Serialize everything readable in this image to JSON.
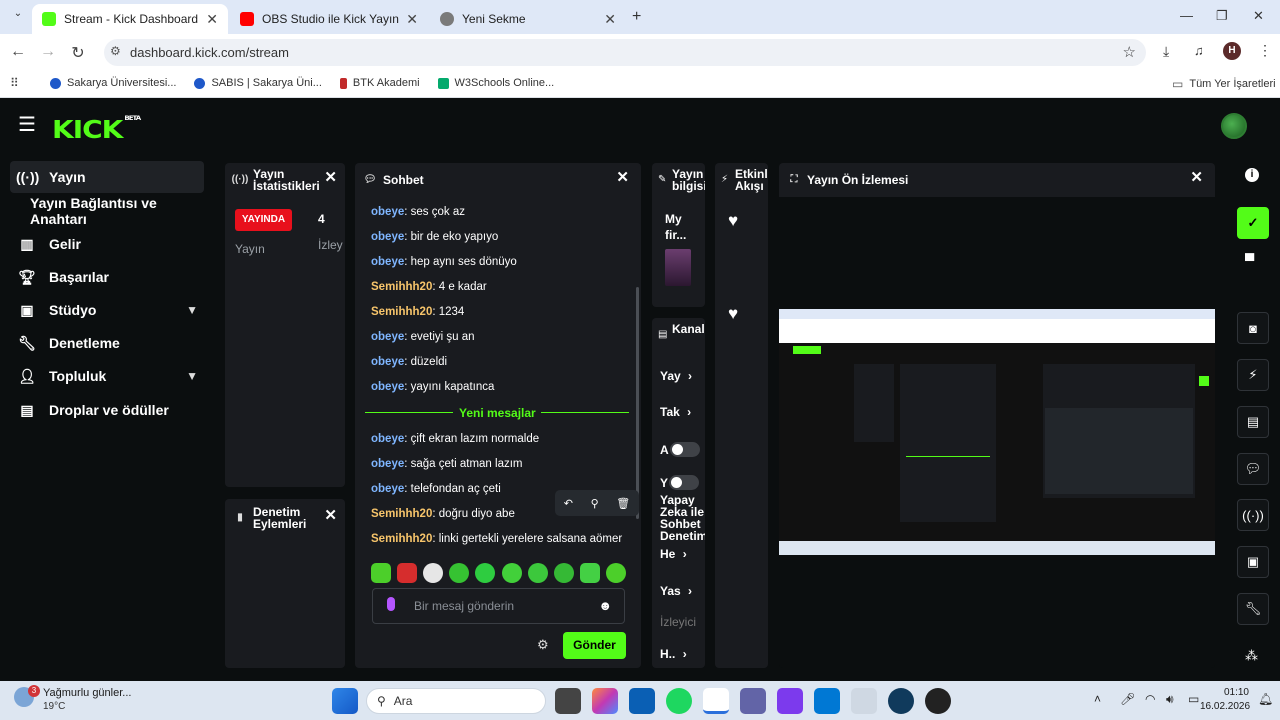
{
  "browser": {
    "tabs": [
      {
        "title": "Stream - Kick Dashboard",
        "color": "#53fc18"
      },
      {
        "title": "OBS Studio ile Kick Yayını Nasıl",
        "color": "#ff0000"
      },
      {
        "title": "Yeni Sekme",
        "color": "#777777"
      }
    ],
    "url": "dashboard.kick.com/stream",
    "profile_initial": "H",
    "bookmarks": [
      "Sakarya Üniversitesi...",
      "SABIS | Sakarya Üni...",
      "BTK Akademi",
      "W3Schools Online..."
    ],
    "all_bookmarks": "Tüm Yer İşaretleri"
  },
  "kick": {
    "logo": "KICK",
    "logo_badge": "BETA",
    "sidebar": [
      {
        "label": "Yayın",
        "icon": "broadcast-icon"
      },
      {
        "label": "Yayın Bağlantısı ve Anahtarı",
        "icon": ""
      },
      {
        "label": "Gelir",
        "icon": "chart-icon"
      },
      {
        "label": "Başarılar",
        "icon": "trophy-icon"
      },
      {
        "label": "Stüdyo",
        "icon": "studio-icon"
      },
      {
        "label": "Denetleme",
        "icon": "wrench-icon"
      },
      {
        "label": "Topluluk",
        "icon": "person-icon"
      },
      {
        "label": "Droplar ve ödüller",
        "icon": "drops-icon"
      }
    ],
    "stats": {
      "title": "Yayın İstatistikleri",
      "live": "YAYINDA",
      "count": "4",
      "label1": "Yayın",
      "label2": "İzley"
    },
    "mod_actions": {
      "title": "Denetim Eylemleri"
    },
    "chat": {
      "title": "Sohbet",
      "messages": [
        {
          "user": "obeye",
          "text": "ses çok az"
        },
        {
          "user": "obeye",
          "text": "bir de eko yapıyo"
        },
        {
          "user": "obeye",
          "text": "hep aynı ses dönüyo"
        },
        {
          "user": "Semihhh20",
          "text": "4 e kadar"
        },
        {
          "user": "Semihhh20",
          "text": "1234"
        },
        {
          "user": "obeye",
          "text": "evetiyi şu an"
        },
        {
          "user": "obeye",
          "text": "düzeldi"
        },
        {
          "user": "obeye",
          "text": "yayını kapatınca"
        }
      ],
      "new_label": "Yeni mesajlar",
      "new_messages": [
        {
          "user": "obeye",
          "text": "çift ekran lazım normalde"
        },
        {
          "user": "obeye",
          "text": "sağa çeti atman lazım"
        },
        {
          "user": "obeye",
          "text": "telefondan aç çeti"
        },
        {
          "user": "Semihhh20",
          "text": "doğru diyo abe"
        },
        {
          "user": "Semihhh20",
          "text": "linki gertekli yerelere salsana aömer"
        }
      ],
      "placeholder": "Bir mesaj gönderin",
      "send": "Gönder"
    },
    "stream_info": {
      "title": "Yayın bilgisi",
      "name": "My fir..."
    },
    "activity": {
      "title": "Etkinlik Akışı"
    },
    "channel_actions": {
      "title": "Kanal Eylem",
      "items": [
        "Yay",
        "Tak",
        "A",
        "Y"
      ]
    },
    "ai_mod": {
      "title": "Yapay Zeka ile Sohbet Denetim",
      "items": [
        "He",
        "Yas",
        "İzleyici",
        "H.."
      ]
    },
    "preview": {
      "title": "Yayın Ön İzlemesi"
    }
  },
  "taskbar": {
    "weather": "Yağmurlu günler...",
    "temp": "19°C",
    "badge": "3",
    "search": "Ara",
    "time": "01:10",
    "date": "16.02.2026"
  },
  "colors": {
    "accent": "#53fc18",
    "live": "#e8101c",
    "user_a": "#7fb6ff",
    "user_b": "#f7c56b"
  }
}
